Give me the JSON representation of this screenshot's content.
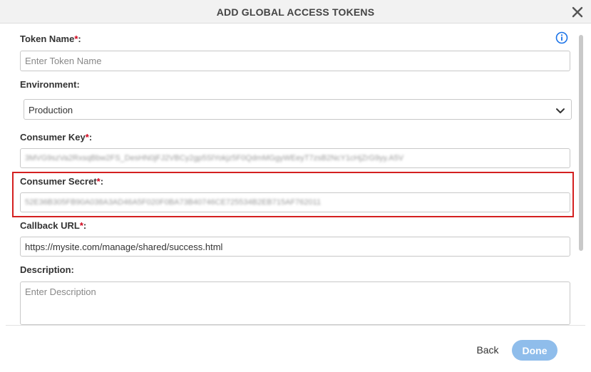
{
  "dialog": {
    "title": "ADD GLOBAL ACCESS TOKENS",
    "close_icon": "close-icon",
    "info_icon": "info-icon"
  },
  "form": {
    "token_name": {
      "label": "Token Name",
      "required_mark": "*",
      "suffix": ":",
      "value": "",
      "placeholder": "Enter Token Name"
    },
    "environment": {
      "label": "Environment:",
      "selected": "Production",
      "chevron_icon": "chevron-down-icon"
    },
    "consumer_key": {
      "label": "Consumer Key",
      "required_mark": "*",
      "suffix": ":",
      "value": "3MVG9szVa2RxsqBbw2FS_DesHN0jFJ2VBCy2gp5SlYokjz5F0QdmMGgyWEeyT7zsB2NcY1cHjZrG9yy.A5V"
    },
    "consumer_secret": {
      "label": "Consumer Secret",
      "required_mark": "*",
      "suffix": ":",
      "value": "52E36B305FB90A038A3AD46A5F020F0BA73B40746CE725534B2EB715AF762011"
    },
    "callback_url": {
      "label": "Callback URL",
      "required_mark": "*",
      "suffix": ":",
      "value": "https://mysite.com/manage/shared/success.html"
    },
    "description": {
      "label": "Description:",
      "value": "",
      "placeholder": "Enter Description"
    }
  },
  "footer": {
    "back_label": "Back",
    "done_label": "Done"
  },
  "colors": {
    "required": "#d0021b",
    "highlight": "#d42020",
    "done_button": "#8fbdeb",
    "info": "#1a73e8"
  }
}
